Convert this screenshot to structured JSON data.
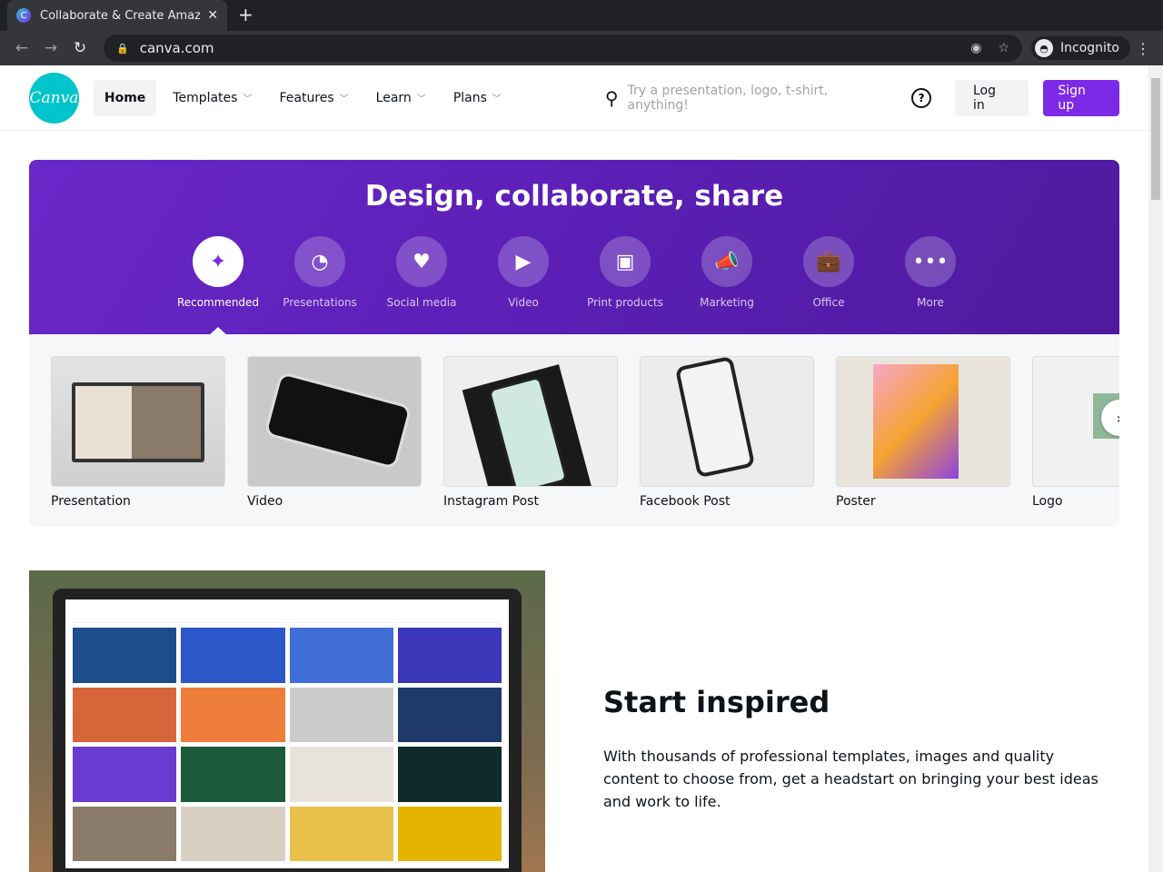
{
  "browser": {
    "tab_title": "Collaborate & Create Amazing",
    "url": "canva.com",
    "profile": "Incognito"
  },
  "header": {
    "logo": "Canva",
    "nav": [
      {
        "label": "Home"
      },
      {
        "label": "Templates"
      },
      {
        "label": "Features"
      },
      {
        "label": "Learn"
      },
      {
        "label": "Plans"
      }
    ],
    "search_placeholder": "Try a presentation, logo, t-shirt, anything!",
    "help": "?",
    "login": "Log in",
    "signup": "Sign up"
  },
  "hero": {
    "title": "Design, collaborate, share",
    "categories": [
      {
        "label": "Recommended",
        "icon": "sparkle-icon"
      },
      {
        "label": "Presentations",
        "icon": "presentation-icon"
      },
      {
        "label": "Social media",
        "icon": "heart-bubble-icon"
      },
      {
        "label": "Video",
        "icon": "video-camera-icon"
      },
      {
        "label": "Print products",
        "icon": "print-icon"
      },
      {
        "label": "Marketing",
        "icon": "megaphone-icon"
      },
      {
        "label": "Office",
        "icon": "briefcase-icon"
      },
      {
        "label": "More",
        "icon": "more-icon"
      }
    ]
  },
  "templates": [
    {
      "label": "Presentation"
    },
    {
      "label": "Video"
    },
    {
      "label": "Instagram Post"
    },
    {
      "label": "Facebook Post"
    },
    {
      "label": "Poster"
    },
    {
      "label": "Logo"
    }
  ],
  "inspired": {
    "title": "Start inspired",
    "body": "With thousands of professional templates, images and quality content to choose from, get a headstart on bringing your best ideas and work to life."
  },
  "colors": {
    "brand": "#7d2ae8",
    "logo": "#00c4cc"
  }
}
